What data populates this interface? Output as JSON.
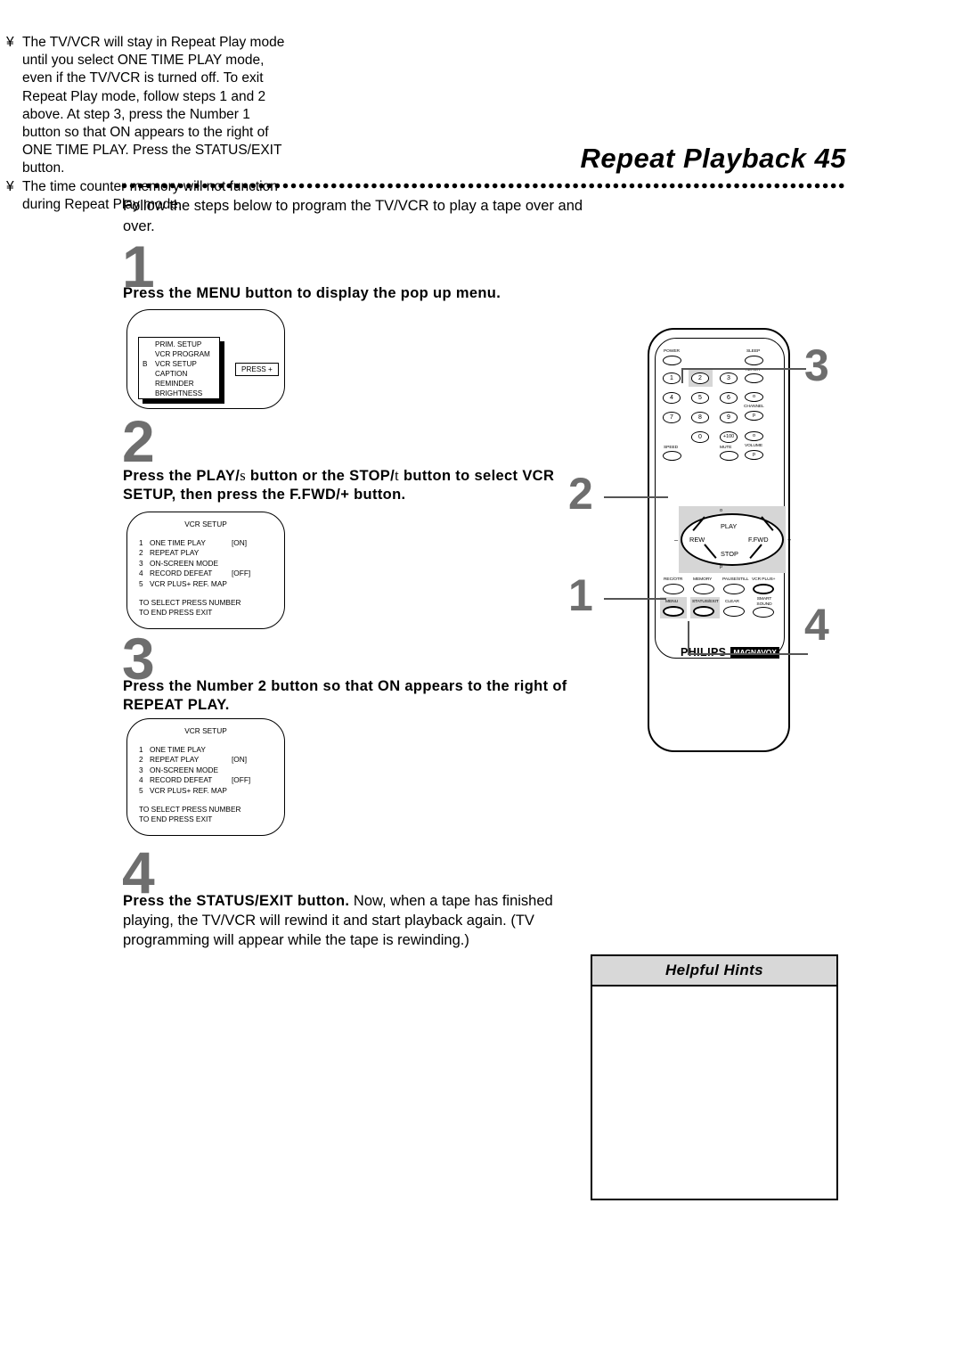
{
  "header": {
    "title": "Repeat Playback  45"
  },
  "intro": "Follow the steps below to program the TV/VCR to play a tape over and over.",
  "steps": [
    {
      "number": "1",
      "heading": "Press the MENU button to display the pop up menu."
    },
    {
      "number": "2",
      "heading_part1": "Press the PLAY/",
      "heading_sym1": "s",
      "heading_part2": " button or the STOP/",
      "heading_sym2": "t",
      "heading_part3": " button to select VCR SETUP, then press the F.FWD/+ button."
    },
    {
      "number": "3",
      "heading": "Press the Number 2 button so that ON appears to the right of REPEAT PLAY."
    },
    {
      "number": "4",
      "heading_bold": "Press the STATUS/EXIT button.",
      "heading_rest": " Now, when a tape has finished playing, the TV/VCR will rewind it and start playback again. (TV programming will appear while the tape is rewinding.)"
    }
  ],
  "popup_menu": {
    "cursor_marker": "B",
    "items": [
      "PRIM. SETUP",
      "VCR PROGRAM",
      "VCR SETUP",
      "CAPTION",
      "REMINDER",
      "BRIGHTNESS"
    ],
    "selected_index": 2,
    "press_plus_label": "PRESS +"
  },
  "vcr_setup_screen_step2": {
    "title": "VCR SETUP",
    "rows": [
      {
        "num": "1",
        "label": "ONE TIME PLAY",
        "value": "[ON]"
      },
      {
        "num": "2",
        "label": "REPEAT PLAY",
        "value": ""
      },
      {
        "num": "3",
        "label": "ON-SCREEN MODE",
        "value": ""
      },
      {
        "num": "4",
        "label": "RECORD DEFEAT",
        "value": "[OFF]"
      },
      {
        "num": "5",
        "label": "VCR PLUS+ REF. MAP",
        "value": ""
      }
    ],
    "footer1": "TO SELECT PRESS NUMBER",
    "footer2": "TO END PRESS EXIT"
  },
  "vcr_setup_screen_step3": {
    "title": "VCR SETUP",
    "rows": [
      {
        "num": "1",
        "label": "ONE TIME PLAY",
        "value": ""
      },
      {
        "num": "2",
        "label": "REPEAT PLAY",
        "value": "[ON]"
      },
      {
        "num": "3",
        "label": "ON-SCREEN MODE",
        "value": ""
      },
      {
        "num": "4",
        "label": "RECORD DEFEAT",
        "value": "[OFF]"
      },
      {
        "num": "5",
        "label": "VCR PLUS+ REF. MAP",
        "value": ""
      }
    ],
    "footer1": "TO SELECT PRESS NUMBER",
    "footer2": "TO END PRESS EXIT"
  },
  "remote": {
    "brand_primary": "PHILIPS",
    "brand_secondary": "MAGNAVOX",
    "buttons": {
      "power": "POWER",
      "sleep": "SLEEP",
      "alt_ch": "ALT.CH",
      "speed": "SPEED",
      "mute": "MUTE",
      "channel": "CHANNEL",
      "volume": "VOLUME",
      "n1": "1",
      "n2": "2",
      "n3": "3",
      "n4": "4",
      "n5": "5",
      "n6": "6",
      "n7": "7",
      "n8": "8",
      "n9": "9",
      "n0": "0",
      "plus100": "+100",
      "play": "PLAY",
      "rew": "REW",
      "ffwd": "F.FWD",
      "stop": "STOP",
      "minus": "–",
      "plus": "+",
      "up_arrow": "o",
      "down_arrow": "p",
      "rec_otr": "REC/OTR",
      "memory": "MEMORY",
      "pause_still": "PAUSE/STILL",
      "vcr_plus": "VCR PLUS+",
      "menu": "MENU",
      "status_exit": "STATUS/EXIT",
      "clear": "CLEAR",
      "smart_sound": "SMART SOUND"
    },
    "callouts": [
      "1",
      "2",
      "3",
      "4"
    ]
  },
  "helpful_hints": {
    "title": "Helpful Hints",
    "bullet": "¥",
    "items": [
      "The TV/VCR will stay in Repeat Play mode until you select ONE TIME PLAY mode, even if the TV/VCR is turned off. To exit Repeat Play mode, follow steps 1 and 2 above. At step 3, press the Number 1 button so that ON appears to the right of ONE TIME PLAY.  Press the STATUS/EXIT button.",
      "The time counter memory will not function during Repeat Play mode."
    ]
  }
}
